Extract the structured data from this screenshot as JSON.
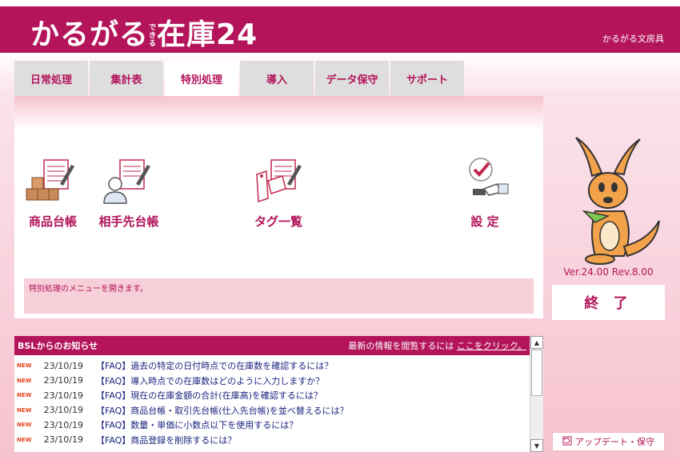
{
  "header": {
    "logo_main": "かるがる",
    "logo_tiny": "できる",
    "logo_suffix": "在庫24",
    "company": "かるがる文房具"
  },
  "tabs": [
    {
      "label": "日常処理"
    },
    {
      "label": "集計表"
    },
    {
      "label": "特別処理",
      "active": true
    },
    {
      "label": "導入"
    },
    {
      "label": "データ保守"
    },
    {
      "label": "サポート"
    }
  ],
  "menu": {
    "item_goods": "商品台帳",
    "item_partner": "相手先台帳",
    "item_tags": "タグ一覧",
    "item_settings": "設 定"
  },
  "status_text": "特別処理のメニューを開きます。",
  "version": "Ver.24.00 Rev.8.00",
  "exit_label": "終 了",
  "update_label": "アップデート・保守",
  "news": {
    "title": "BSLからのお知らせ",
    "note": "最新の情報を閲覧するには",
    "link": "ここをクリック。",
    "badge": "NEW",
    "items": [
      {
        "date": "23/10/19",
        "title": "【FAQ】過去の特定の日付時点での在庫数を確認するには？"
      },
      {
        "date": "23/10/19",
        "title": "【FAQ】導入時点での在庫数はどのように入力しますか？"
      },
      {
        "date": "23/10/19",
        "title": "【FAQ】現在の在庫金額の合計(在庫高)を確認するには？"
      },
      {
        "date": "23/10/19",
        "title": "【FAQ】商品台帳・取引先台帳(仕入先台帳)を並べ替えるには？"
      },
      {
        "date": "23/10/19",
        "title": "【FAQ】数量・単価に小数点以下を使用するには？"
      },
      {
        "date": "23/10/19",
        "title": "【FAQ】商品登録を削除するには？"
      }
    ]
  },
  "colors": {
    "brand": "#b3145a",
    "tab_bg": "#dedede",
    "status_bg": "#f7cfd8"
  },
  "icons": [
    "boxes-ledger-icon",
    "person-ledger-icon",
    "tag-ledger-icon",
    "settings-check-icon",
    "kangaroo-mascot",
    "update-icon"
  ]
}
